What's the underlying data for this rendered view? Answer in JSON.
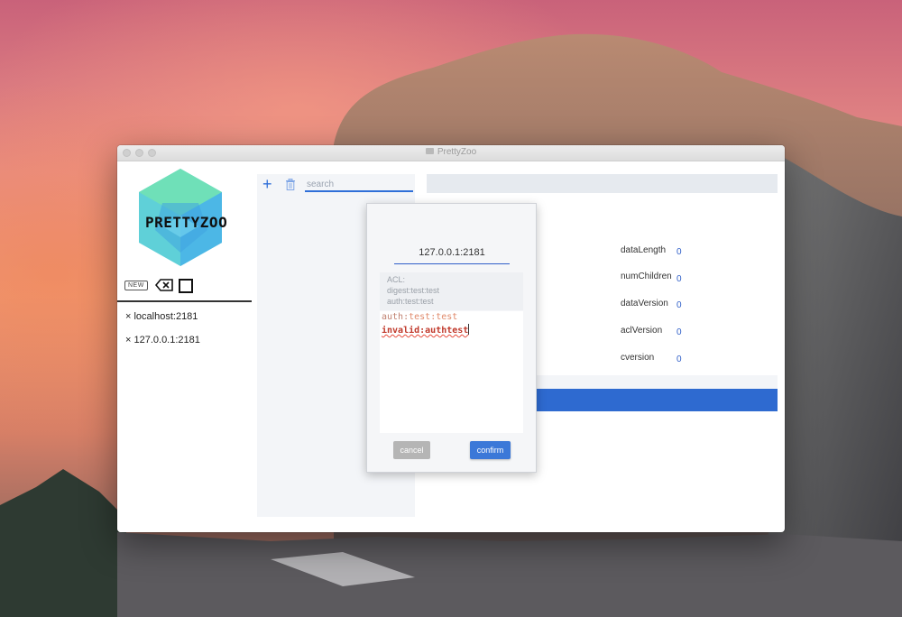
{
  "window": {
    "title": "PrettyZoo"
  },
  "sidebar": {
    "logo_text": "PRETTYZOO",
    "new_label": "NEW",
    "servers": [
      {
        "label": "× localhost:2181"
      },
      {
        "label": "× 127.0.0.1:2181"
      }
    ]
  },
  "tree": {
    "add_icon": "plus-icon",
    "delete_icon": "trash-icon",
    "search_placeholder": "search"
  },
  "node_stats": [
    {
      "label": "dataLength",
      "value": "0"
    },
    {
      "label": "numChildren",
      "value": "0"
    },
    {
      "label": "dataVersion",
      "value": "0"
    },
    {
      "label": "aclVersion",
      "value": "0"
    },
    {
      "label": "cversion",
      "value": "0"
    }
  ],
  "dialog": {
    "host": "127.0.0.1:2181",
    "acl_lines": [
      "ACL:",
      "digest:test:test",
      "auth:test:test"
    ],
    "editor": {
      "line1": {
        "kw": "auth:",
        "val": "test:test"
      },
      "line2": "invalid:authtest"
    },
    "cancel_label": "cancel",
    "confirm_label": "confirm"
  },
  "colors": {
    "accent": "#2e6ad0",
    "confirm": "#3b78d8",
    "cancel": "#b5b5b5"
  }
}
